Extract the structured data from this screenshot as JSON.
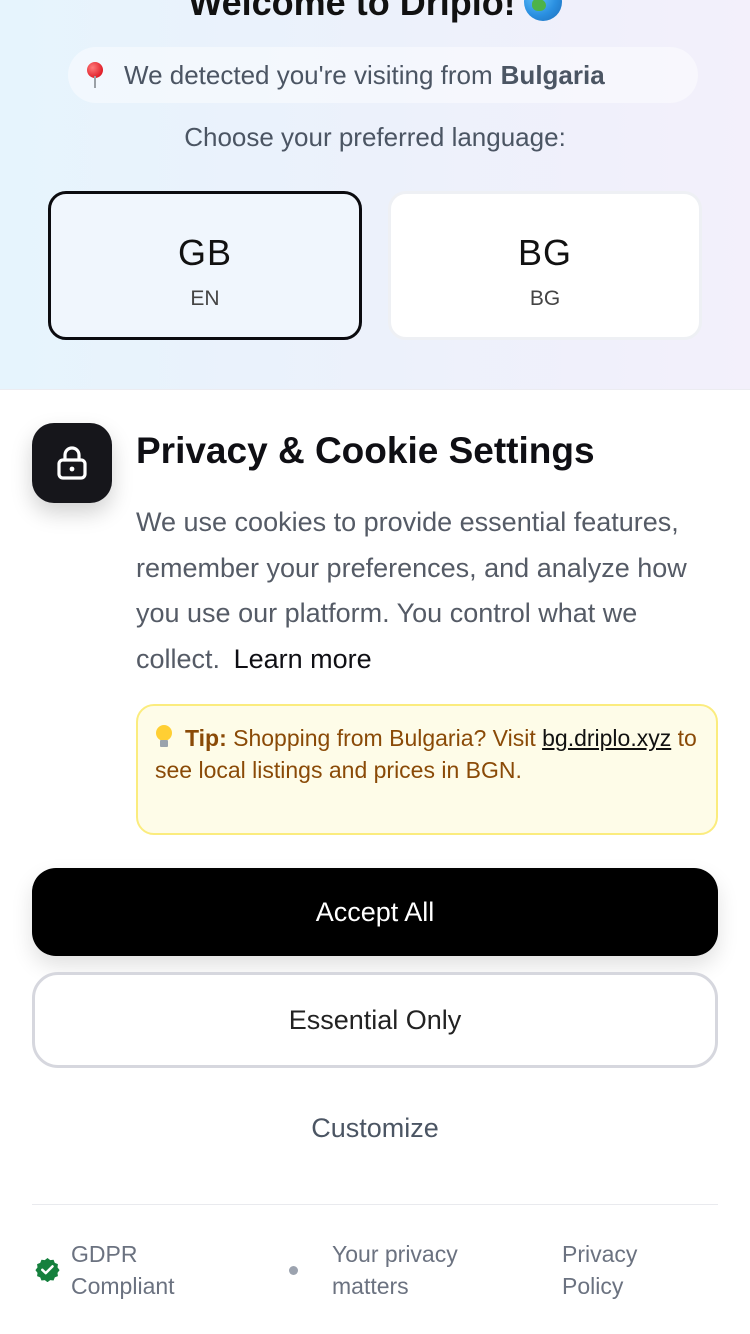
{
  "welcome": {
    "title": "Welcome to Driplo!"
  },
  "detection": {
    "prefix": "We detected you're visiting from",
    "country": "Bulgaria"
  },
  "language": {
    "prompt": "Choose your preferred language:",
    "options": [
      {
        "code": "GB",
        "label": "EN",
        "selected": true
      },
      {
        "code": "BG",
        "label": "BG",
        "selected": false
      }
    ]
  },
  "privacy": {
    "title": "Privacy & Cookie Settings",
    "description": "We use cookies to provide essential features, remember your preferences, and analyze how you use our platform. You control what we collect.",
    "learn_more": "Learn more",
    "tip": {
      "label": "Tip:",
      "text_before": "Shopping from Bulgaria? Visit",
      "link": "bg.driplo.xyz",
      "text_after": "to see local listings and prices in BGN."
    },
    "buttons": {
      "accept_all": "Accept All",
      "essential_only": "Essential Only",
      "customize": "Customize"
    }
  },
  "footer": {
    "gdpr": "GDPR Compliant",
    "privacy_matters": "Your privacy matters",
    "privacy_policy": "Privacy Policy"
  },
  "colors": {
    "primary": "#000000",
    "tip_background": "#fefce8",
    "tip_border": "#fbec7e",
    "tip_text": "#8a4a07",
    "gdpr_check": "#15803d"
  },
  "icons": [
    "globe-icon",
    "location-pin-icon",
    "lock-icon",
    "lightbulb-icon",
    "check-circle-icon"
  ]
}
